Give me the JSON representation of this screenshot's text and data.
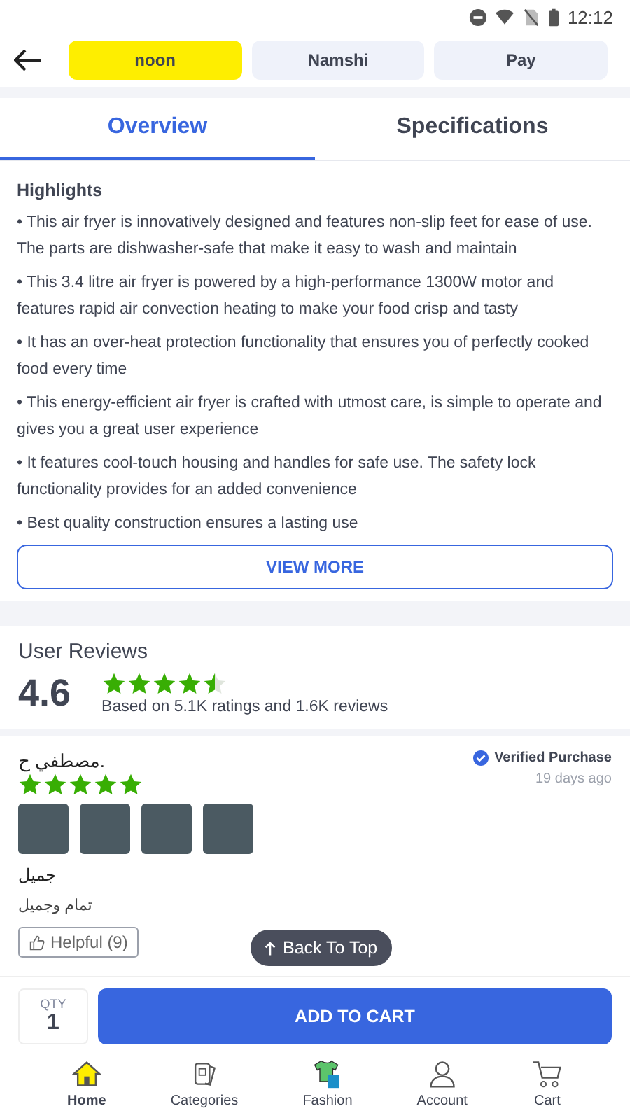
{
  "status_bar": {
    "time": "12:12"
  },
  "brand_tabs": [
    {
      "label": "noon",
      "selected": true
    },
    {
      "label": "Namshi",
      "selected": false
    },
    {
      "label": "Pay",
      "selected": false
    }
  ],
  "tabs": [
    {
      "label": "Overview",
      "selected": true
    },
    {
      "label": "Specifications",
      "selected": false
    }
  ],
  "highlights": {
    "title": "Highlights",
    "items": [
      "• This air fryer is innovatively designed and features non-slip feet for ease of use. The parts are dishwasher-safe that make it easy to wash and maintain",
      "• This 3.4 litre air fryer is powered by a high-performance 1300W motor and features rapid air convection heating to make your food crisp and tasty",
      "• It has an over-heat protection functionality that ensures you of perfectly cooked food every time",
      "• This energy-efficient air fryer is crafted with utmost care,  is simple to operate and gives you a great user experience",
      "• It features cool-touch housing and handles for safe use. The safety lock functionality provides for an added convenience",
      "• Best quality construction ensures a lasting use"
    ],
    "button": "VIEW MORE"
  },
  "reviews": {
    "title": "User Reviews",
    "rating": "4.6",
    "stars": 4.5,
    "summary": "Based on 5.1K ratings and 1.6K reviews",
    "items": [
      {
        "author": "مصطفي ح.",
        "stars": 5,
        "verified": "Verified Purchase",
        "date": "19 days ago",
        "title": "جميل",
        "body": "تمام وجميل",
        "helpful": "Helpful (9)"
      }
    ]
  },
  "back_to_top": "Back To Top",
  "cart_bar": {
    "qty_label": "QTY",
    "qty": "1",
    "button": "ADD TO CART"
  },
  "nav": [
    {
      "label": "Home",
      "selected": true
    },
    {
      "label": "Categories",
      "selected": false
    },
    {
      "label": "Fashion",
      "selected": false
    },
    {
      "label": "Account",
      "selected": false
    },
    {
      "label": "Cart",
      "selected": false
    }
  ]
}
